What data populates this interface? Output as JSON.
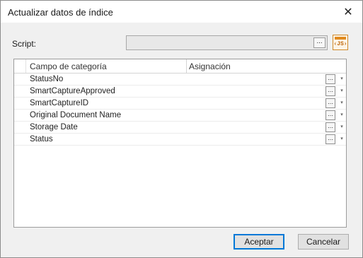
{
  "window": {
    "title": "Actualizar datos de índice",
    "close_glyph": "✕"
  },
  "script": {
    "label": "Script:",
    "value": "",
    "ellipsis": "...",
    "js_label": "‹JS›"
  },
  "grid": {
    "columns": [
      "Campo de categoría",
      "Asignación"
    ],
    "rows": [
      {
        "name": "StatusNo",
        "value": ""
      },
      {
        "name": "SmartCaptureApproved",
        "value": ""
      },
      {
        "name": "SmartCaptureID",
        "value": ""
      },
      {
        "name": "Original Document Name",
        "value": ""
      },
      {
        "name": "Storage Date",
        "value": ""
      },
      {
        "name": "Status",
        "value": ""
      }
    ],
    "cell_button": "...",
    "dropdown_glyph": "▾"
  },
  "buttons": {
    "accept": "Aceptar",
    "cancel": "Cancelar"
  },
  "colors": {
    "focus_border": "#0078d7",
    "js_accent": "#e08a1e"
  }
}
